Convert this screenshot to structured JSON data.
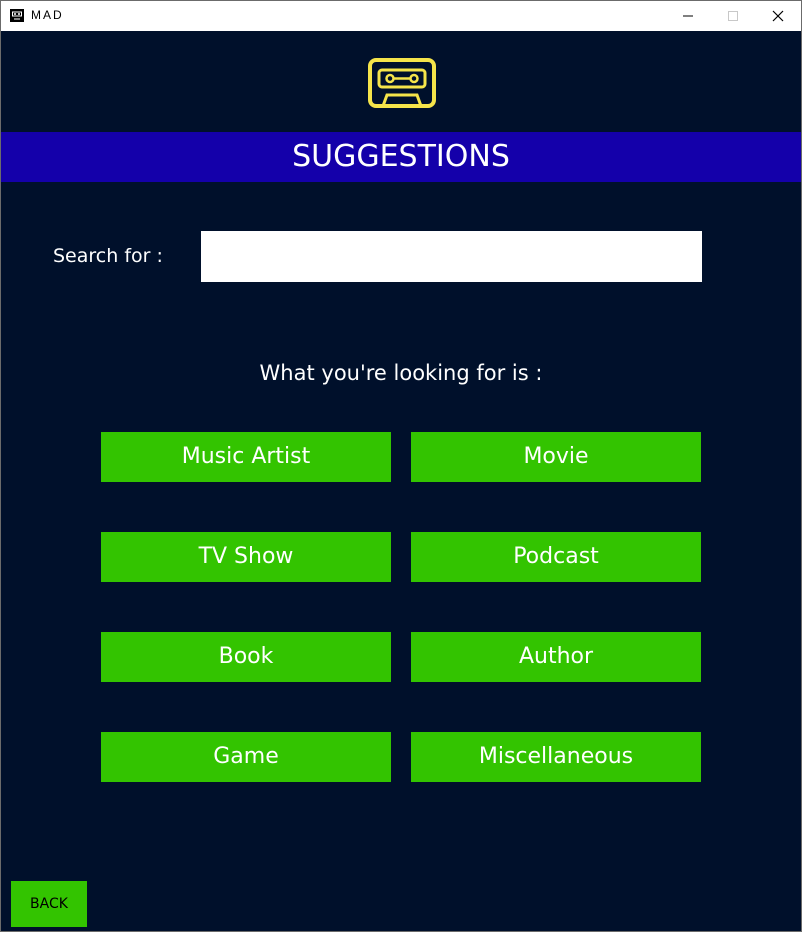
{
  "window": {
    "title": "MAD",
    "app_icon": "cassette-icon",
    "controls": [
      "minimize-icon",
      "maximize-icon",
      "close-icon"
    ]
  },
  "logo": {
    "icon": "cassette-icon",
    "color": "#f5e44a"
  },
  "banner": {
    "title": "SUGGESTIONS",
    "color": "#1400aa"
  },
  "search": {
    "label": "Search for :",
    "value": "",
    "placeholder": ""
  },
  "prompt": "What you're looking for is :",
  "categories": [
    "Music Artist",
    "Movie",
    "TV Show",
    "Podcast",
    "Book",
    "Author",
    "Game",
    "Miscellaneous"
  ],
  "back_label": "BACK",
  "colors": {
    "background": "#00102b",
    "button": "#33c400",
    "banner": "#1400aa"
  }
}
